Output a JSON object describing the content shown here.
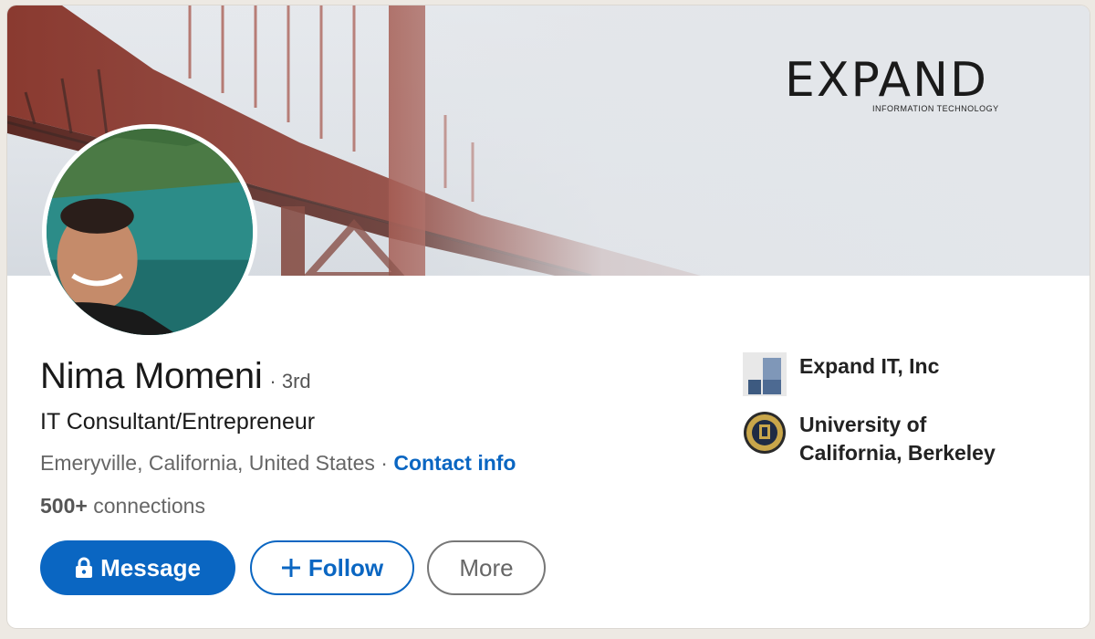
{
  "banner": {
    "brand_name": "EXPAND",
    "brand_tagline": "INFORMATION TECHNOLOGY",
    "colors": {
      "bridge": "#9a3a2c",
      "fog": "#dfe3e8",
      "brand_accent": "#d7191c"
    }
  },
  "profile": {
    "name": "Nima Momeni",
    "degree": "· 3rd",
    "headline": "IT Consultant/Entrepreneur",
    "location": "Emeryville, California, United States",
    "separator": " · ",
    "contact_info": "Contact info",
    "connections_count": "500+",
    "connections_label": " connections"
  },
  "actions": {
    "message": "Message",
    "message_icon": "lock-icon",
    "follow": "Follow",
    "follow_icon": "plus-icon",
    "more": "More"
  },
  "experience": [
    {
      "label": "Expand IT, Inc",
      "logo": "company-logo"
    },
    {
      "label_line1": "University of",
      "label_line2": "California, Berkeley",
      "logo": "university-seal"
    }
  ],
  "colors": {
    "accent": "#0a66c2",
    "text": "#191919",
    "muted": "#666666"
  }
}
